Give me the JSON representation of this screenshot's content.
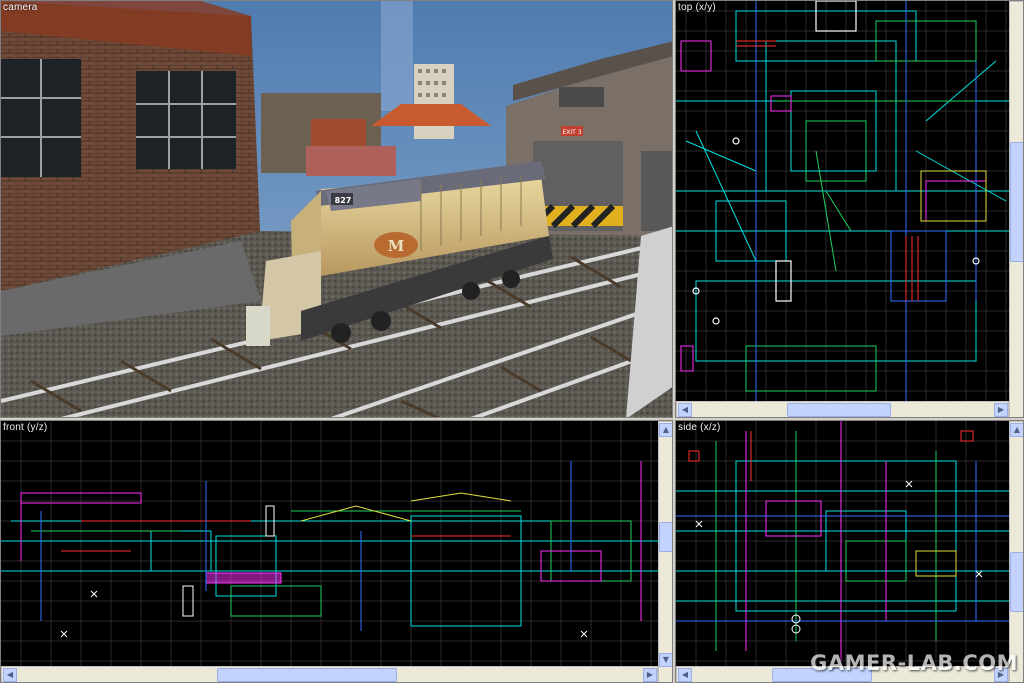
{
  "viewports": {
    "camera": {
      "label": "camera"
    },
    "top": {
      "label": "top (x/y)"
    },
    "front": {
      "label": "front (y/z)"
    },
    "side": {
      "label": "side (x/z)"
    }
  },
  "scene": {
    "locomotive_number": "827",
    "locomotive_logo": "M",
    "building_sign": "EXIT 3"
  },
  "scrollbars": {
    "left_arrow": "◀",
    "right_arrow": "▶",
    "up_arrow": "▲",
    "down_arrow": "▼"
  },
  "watermark": "GAMER-LAB.COM",
  "colors": {
    "grid": "#2a2a2a",
    "wire_cyan": "#00e0e0",
    "wire_green": "#20d060",
    "wire_magenta": "#ff30ff",
    "wire_blue": "#3070ff",
    "wire_white": "#ffffff",
    "wire_red": "#ff3030",
    "wire_yellow": "#e0e040",
    "sky": "#5b87b8"
  }
}
